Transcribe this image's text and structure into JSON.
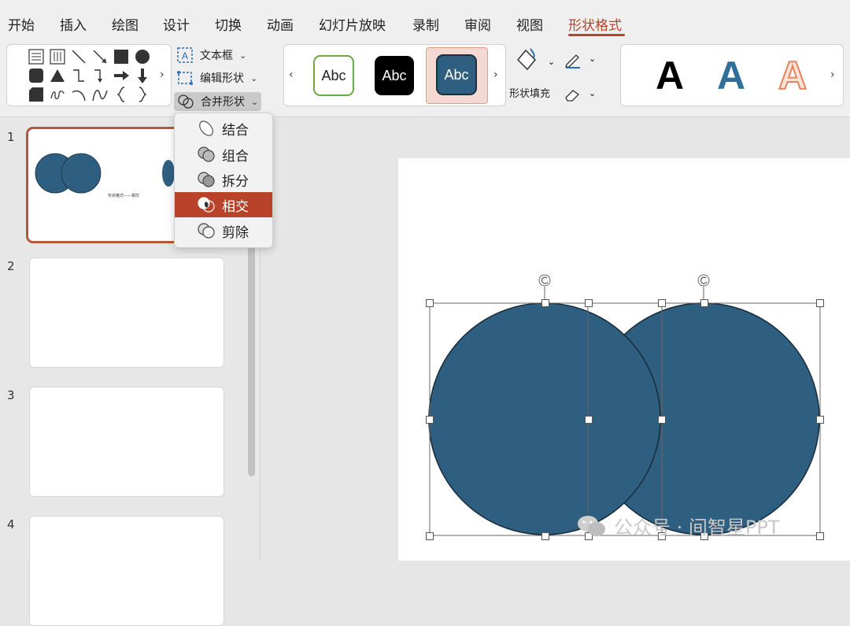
{
  "tabs": [
    {
      "label": "开始"
    },
    {
      "label": "插入"
    },
    {
      "label": "绘图"
    },
    {
      "label": "设计"
    },
    {
      "label": "切换"
    },
    {
      "label": "动画"
    },
    {
      "label": "幻灯片放映"
    },
    {
      "label": "录制"
    },
    {
      "label": "审阅"
    },
    {
      "label": "视图"
    },
    {
      "label": "形状格式"
    }
  ],
  "ribbon": {
    "text_box": "文本框",
    "edit_shape": "编辑形状",
    "merge_shapes": "合并形状",
    "style_sample": "Abc",
    "shape_fill": "形状填充",
    "wordart_letter": "A"
  },
  "merge_menu": {
    "items": [
      {
        "label": "结合"
      },
      {
        "label": "组合"
      },
      {
        "label": "拆分"
      },
      {
        "label": "相交"
      },
      {
        "label": "剪除"
      }
    ],
    "selected": "相交"
  },
  "thumbnails": {
    "numbers": [
      "1",
      "2",
      "3",
      "4"
    ],
    "caption": "形状格式——相交"
  },
  "colors": {
    "accent": "#b8432a",
    "shape_fill": "#2f5f80",
    "shape_outline": "#1a2e3d"
  },
  "watermark": "公众号 · 间智星PPT"
}
